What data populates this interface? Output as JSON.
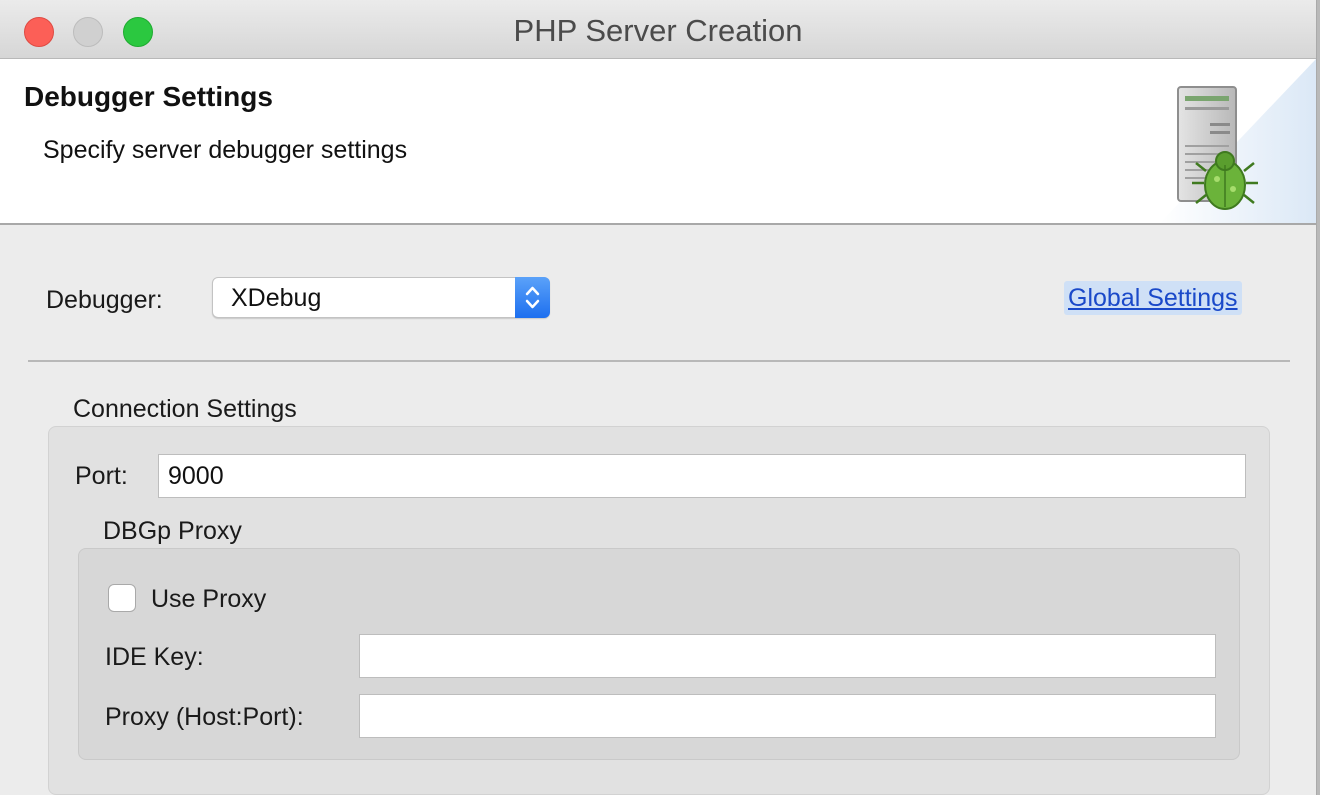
{
  "window": {
    "title": "PHP Server Creation"
  },
  "banner": {
    "title": "Debugger Settings",
    "description": "Specify server debugger settings",
    "icon": "server-bug-icon"
  },
  "debugger": {
    "label": "Debugger:",
    "selected": "XDebug",
    "global_settings_link": "Global Settings"
  },
  "connection": {
    "group_label": "Connection Settings",
    "port_label": "Port:",
    "port_value": "9000",
    "proxy": {
      "group_label": "DBGp Proxy",
      "use_proxy_label": "Use Proxy",
      "use_proxy_checked": false,
      "ide_key_label": "IDE Key:",
      "ide_key_value": "",
      "host_port_label": "Proxy (Host:Port):",
      "host_port_value": ""
    }
  },
  "colors": {
    "accent": "#1d6fef",
    "link": "#1a49c9",
    "close": "#fc5f57",
    "maximize": "#2bc840"
  }
}
